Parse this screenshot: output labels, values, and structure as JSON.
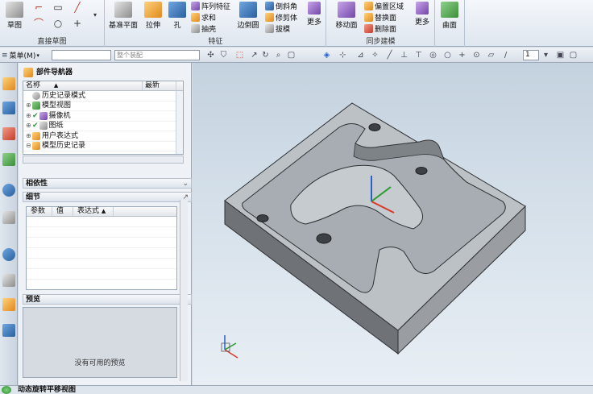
{
  "ribbon": {
    "sketch_big": "草图",
    "direct_sketch_group": "直接草图",
    "datum_plane": "基准平面",
    "extrude": "拉伸",
    "hole": "孔",
    "pattern_feature": "阵列特征",
    "unite": "求和",
    "shell": "抽壳",
    "edge_blend": "边倒圆",
    "chamfer": "倒斜角",
    "trim_body": "修剪体",
    "draft": "拔模",
    "more1": "更多",
    "feature_group": "特征",
    "move_face": "移动面",
    "offset_region": "偏置区域",
    "replace_face": "替换面",
    "delete_face": "删除面",
    "more2": "更多",
    "sync_group": "同步建模",
    "surface": "曲面"
  },
  "selbar": {
    "menu_label": "菜单(M)",
    "filter_value": "整个装配",
    "page_value": "1"
  },
  "navigator": {
    "title": "部件导航器",
    "col_name": "名称",
    "col_latest": "最新",
    "items": [
      {
        "label": "历史记录模式"
      },
      {
        "label": "模型视图"
      },
      {
        "label": "摄像机"
      },
      {
        "label": "图纸"
      },
      {
        "label": "用户表达式"
      },
      {
        "label": "模型历史记录"
      }
    ],
    "dependencies": "相依性",
    "details": "细节",
    "detail_cols": [
      "参数",
      "值",
      "表达式"
    ],
    "preview": "预览",
    "no_preview": "没有可用的预览"
  },
  "status": {
    "text": "动态旋转平移视图"
  },
  "colors": {
    "part_top": "#b9bec3",
    "part_side": "#6d7278",
    "part_front": "#8d9196",
    "axis_x": "#d63a2c",
    "axis_y": "#2a9a2a",
    "axis_z": "#2a5fc8"
  }
}
